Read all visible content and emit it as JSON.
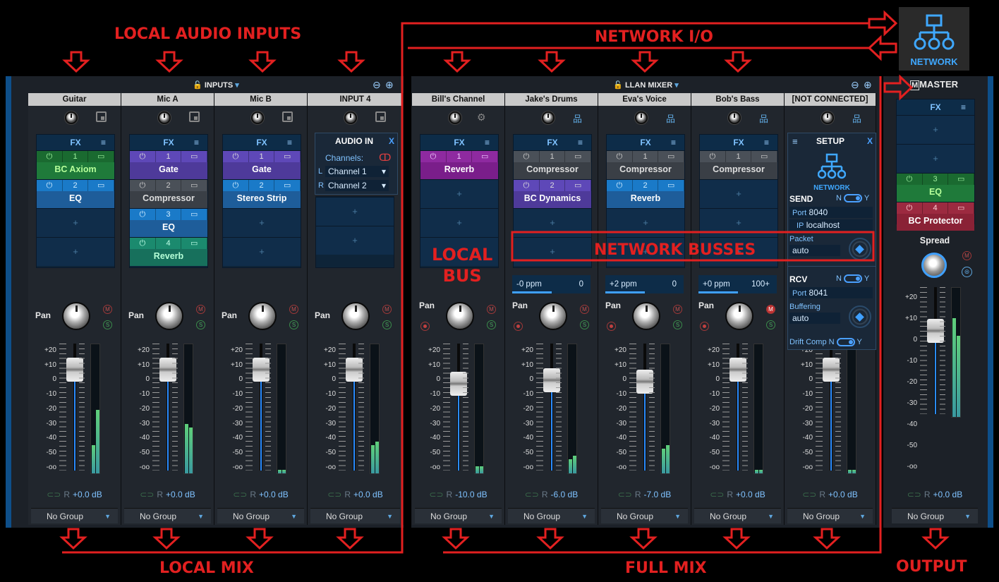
{
  "annotations": {
    "local_audio_inputs": "LOCAL AUDIO INPUTS",
    "network_io": "NETWORK I/O",
    "local_bus": "LOCAL\nBUS",
    "network_busses": "NETWORK BUSSES",
    "local_mix": "LOCAL MIX",
    "full_mix": "FULL MIX",
    "output": "OUTPUT"
  },
  "network_badge": {
    "label": "NETWORK"
  },
  "inputs_header": {
    "title": "INPUTS",
    "arrow": "▾"
  },
  "llan_header": {
    "title": "LLAN MIXER",
    "arrow": "▾"
  },
  "master_header": {
    "title": "MASTER",
    "mark": "M"
  },
  "scale_labels": [
    "+20",
    "+10",
    "0",
    "-10",
    "-20",
    "-30",
    "-40",
    "-50",
    "-oo"
  ],
  "channels": [
    {
      "name": "Guitar",
      "gain": "+0.0 dB",
      "group": "No Group",
      "slots": [
        {
          "n": "1",
          "name": "BC Axiom",
          "c": "green"
        },
        {
          "n": "2",
          "name": "EQ",
          "c": "blue"
        }
      ]
    },
    {
      "name": "Mic A",
      "gain": "+0.0 dB",
      "group": "No Group",
      "slots": [
        {
          "n": "1",
          "name": "Gate",
          "c": "purple"
        },
        {
          "n": "2",
          "name": "Compressor",
          "c": "gray"
        },
        {
          "n": "3",
          "name": "EQ",
          "c": "blue"
        },
        {
          "n": "4",
          "name": "Reverb",
          "c": "teal"
        }
      ]
    },
    {
      "name": "Mic B",
      "gain": "+0.0 dB",
      "group": "No Group",
      "slots": [
        {
          "n": "1",
          "name": "Gate",
          "c": "purple"
        },
        {
          "n": "2",
          "name": "Stereo Strip",
          "c": "blue"
        }
      ]
    },
    {
      "name": "INPUT 4",
      "gain": "+0.0 dB",
      "group": "No Group",
      "slots": []
    },
    {
      "name": "Bill's Channel",
      "gain": "-10.0 dB",
      "group": "No Group",
      "slots": [
        {
          "n": "1",
          "name": "Reverb",
          "c": "mag"
        }
      ]
    },
    {
      "name": "Jake's Drums",
      "gain": "-6.0 dB",
      "group": "No Group",
      "drift": [
        "-0 ppm",
        "0"
      ],
      "slots": [
        {
          "n": "1",
          "name": "Compressor",
          "c": "gray"
        },
        {
          "n": "2",
          "name": "BC Dynamics",
          "c": "purple"
        }
      ]
    },
    {
      "name": "Eva's Voice",
      "gain": "-7.0 dB",
      "group": "No Group",
      "drift": [
        "+2 ppm",
        "0"
      ],
      "slots": [
        {
          "n": "1",
          "name": "Compressor",
          "c": "gray"
        },
        {
          "n": "2",
          "name": "Reverb",
          "c": "blue"
        }
      ]
    },
    {
      "name": "Bob's Bass",
      "gain": "+0.0 dB",
      "group": "No Group",
      "drift": [
        "+0 ppm",
        "100+"
      ],
      "slots": [
        {
          "n": "1",
          "name": "Compressor",
          "c": "gray"
        }
      ]
    },
    {
      "name": "[NOT CONNECTED]",
      "gain": "+0.0 dB",
      "group": "No Group",
      "slots": []
    }
  ],
  "common": {
    "fx": "FX",
    "menu": "≡",
    "plus": "+",
    "pan": "Pan",
    "m": "M",
    "s": "S",
    "link": "⊂⊃",
    "r": "R",
    "power": "⏻"
  },
  "audio_in": {
    "title": "AUDIO IN",
    "close": "X",
    "channels_label": "Channels:",
    "l": "L",
    "r": "R",
    "ch_l": "Channel 1",
    "ch_r": "Channel 2"
  },
  "setup": {
    "title": "SETUP",
    "close": "X",
    "network": "NETWORK",
    "send": "SEND",
    "n": "N",
    "y": "Y",
    "port_label": "Port",
    "send_port": "8040",
    "ip_label": "IP",
    "ip": "localhost",
    "packet": "Packet",
    "packet_val": "auto",
    "rcv": "RCV",
    "rcv_port": "8041",
    "buffering": "Buffering",
    "buffering_val": "auto",
    "drift_comp": "Drift Comp"
  },
  "master": {
    "gain": "+0.0 dB",
    "group": "No Group",
    "spread": "Spread",
    "slots": [
      {
        "n": "3",
        "name": "EQ",
        "c": "green"
      },
      {
        "n": "4",
        "name": "BC Protector",
        "c": "red"
      }
    ]
  }
}
